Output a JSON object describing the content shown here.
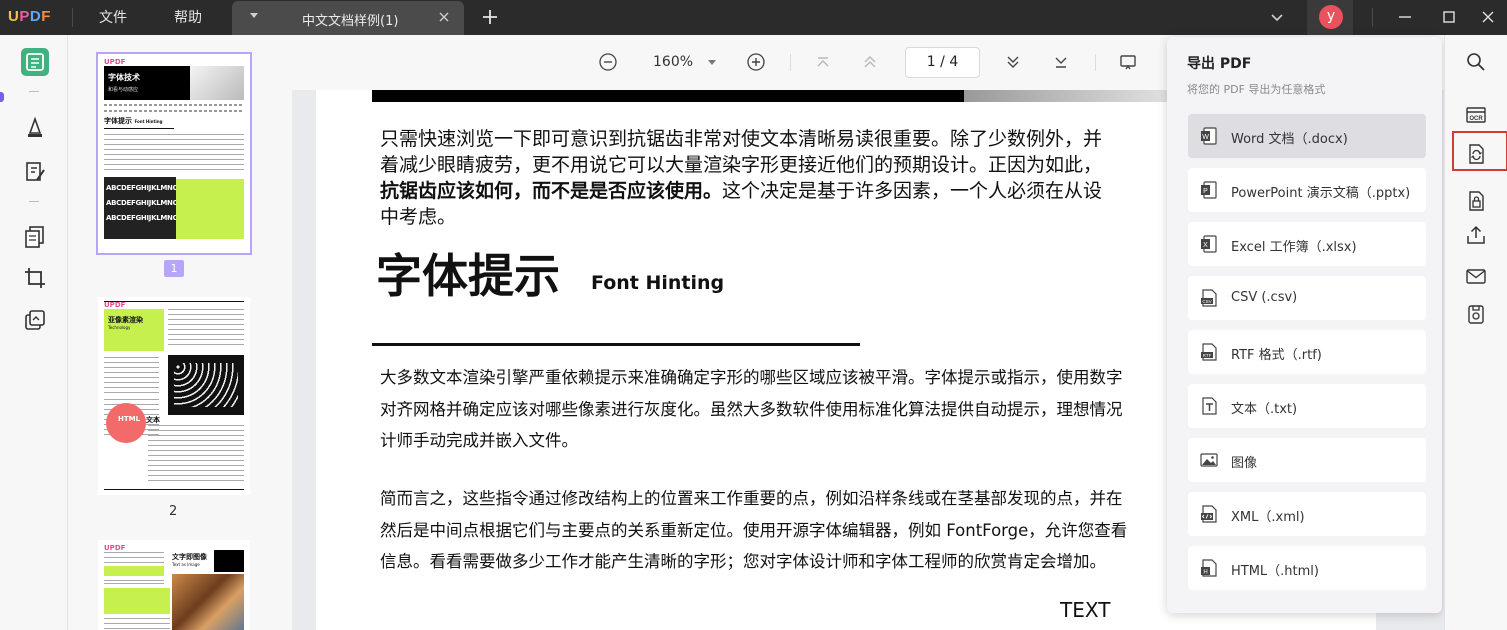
{
  "app": {
    "logo_u": "U",
    "logo_p": "P",
    "logo_d": "D",
    "logo_f": "F"
  },
  "menu": {
    "file": "文件",
    "help": "帮助"
  },
  "tab": {
    "title": "中文文档样例(1)"
  },
  "user": {
    "avatar_letter": "y"
  },
  "toolbar": {
    "zoom": "160%",
    "page_current": "1",
    "page_sep": "/",
    "page_total": "4"
  },
  "thumbnails": {
    "page1_badge": "1",
    "page2_label": "2"
  },
  "thumb_text": {
    "p1_logo": "UPDF",
    "p1_title": "字体技术",
    "p1_subtitle": "和看与动感应",
    "p1_section": "字体提示",
    "p1_section_en": "Font Hinting",
    "p1_strip": "ABCDEFGHIJKLMNO",
    "p2_logo": "UPDF",
    "p2_title": "亚像素渲染",
    "p2_title_en": "Technology",
    "p2_html": "HTML",
    "p2_html_cn": "文本",
    "p3_logo": "UPDF",
    "p3_title": "文字即图像",
    "p3_title_en": "Text as Image"
  },
  "document": {
    "p1_l1": "只需快速浏览一下即可意识到抗锯齿非常对使文本清晰易读很重要。除了少数例外，并",
    "p1_l2": "着减少眼睛疲劳，更不用说它可以大量渲染字形更接近他们的预期设计。正因为如此，",
    "p1_l3_bold": "抗锯齿应该如何，而不是是否应该使用。",
    "p1_l3_rest": "这个决定是基于许多因素，一个人必须在从设",
    "p1_l4": "中考虑。",
    "heading_cn": "字体提示",
    "heading_en": "Font Hinting",
    "p2_l1": "大多数文本渲染引擎严重依赖提示来准确确定字形的哪些区域应该被平滑。字体提示或指示，使用数字",
    "p2_l2": "对齐网格并确定应该对哪些像素进行灰度化。虽然大多数软件使用标准化算法提供自动提示，理想情况",
    "p2_l3": "计师手动完成并嵌入文件。",
    "p3_l1": "简而言之，这些指令通过修改结构上的位置来工作重要的点，例如沿样条线或在茎基部发现的点，并在",
    "p3_l2": "然后是中间点根据它们与主要点的关系重新定位。使用开源字体编辑器，例如 FontForge，允许您查看",
    "p3_l3": "信息。看看需要做多少工作才能产生清晰的字形；您对字体设计师和字体工程师的欣赏肯定会增加。",
    "text_label": "TEXT"
  },
  "export": {
    "title": "导出 PDF",
    "subtitle": "将您的 PDF 导出为任意格式",
    "formats": [
      {
        "label": "Word 文档（.docx)",
        "icon": "word-icon"
      },
      {
        "label": "PowerPoint 演示文稿（.pptx)",
        "icon": "powerpoint-icon"
      },
      {
        "label": "Excel 工作簿（.xlsx)",
        "icon": "excel-icon"
      },
      {
        "label": "CSV (.csv)",
        "icon": "csv-icon"
      },
      {
        "label": "RTF 格式（.rtf)",
        "icon": "rtf-icon"
      },
      {
        "label": "文本（.txt)",
        "icon": "text-icon"
      },
      {
        "label": "图像",
        "icon": "image-icon"
      },
      {
        "label": "XML（.xml)",
        "icon": "xml-icon"
      },
      {
        "label": "HTML（.html)",
        "icon": "html-icon"
      }
    ]
  },
  "colors": {
    "accent_green": "#3fb27f",
    "selection_purple": "#b7a6f7",
    "highlight_red": "#d43b2f",
    "avatar_red": "#e9525c"
  }
}
